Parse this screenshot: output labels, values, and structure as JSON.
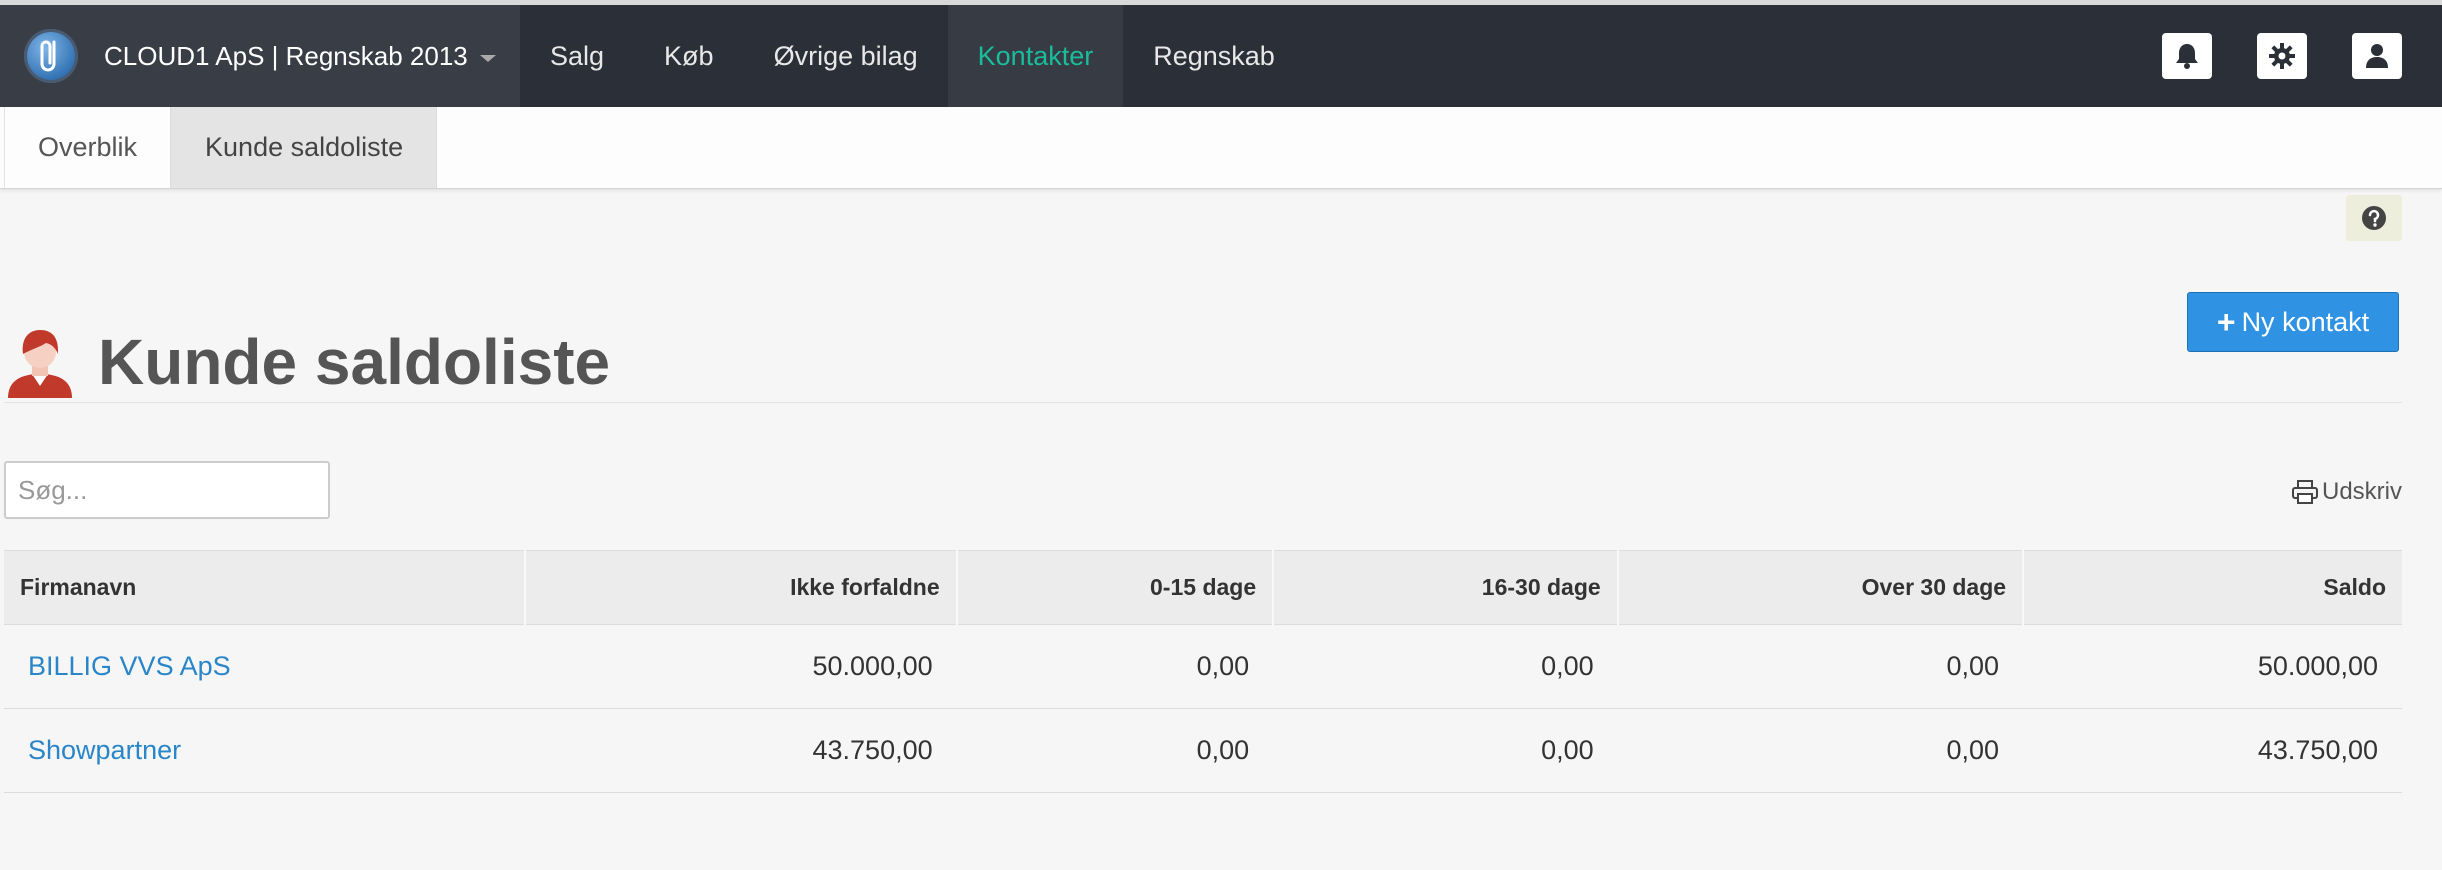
{
  "header": {
    "brand": "CLOUD1 ApS | Regnskab 2013",
    "nav": [
      {
        "label": "Salg"
      },
      {
        "label": "Køb"
      },
      {
        "label": "Øvrige bilag"
      },
      {
        "label": "Kontakter"
      },
      {
        "label": "Regnskab"
      }
    ],
    "active_nav": "Kontakter",
    "icons": [
      "bell-icon",
      "gear-icon",
      "user-icon"
    ],
    "accent_color": "#1abc9c"
  },
  "subnav": {
    "tabs": [
      {
        "label": "Overblik"
      },
      {
        "label": "Kunde saldoliste"
      }
    ],
    "active_tab": "Kunde saldoliste"
  },
  "page": {
    "title": "Kunde saldoliste",
    "new_button": "Ny kontakt",
    "search_placeholder": "Søg...",
    "print_label": "Udskriv"
  },
  "table": {
    "columns": [
      "Firmanavn",
      "Ikke forfaldne",
      "0-15 dage",
      "16-30 dage",
      "Over 30 dage",
      "Saldo"
    ],
    "rows": [
      {
        "name": "BILLIG VVS ApS",
        "not_due": "50.000,00",
        "d0_15": "0,00",
        "d16_30": "0,00",
        "over30": "0,00",
        "balance": "50.000,00"
      },
      {
        "name": "Showpartner",
        "not_due": "43.750,00",
        "d0_15": "0,00",
        "d16_30": "0,00",
        "over30": "0,00",
        "balance": "43.750,00"
      }
    ]
  }
}
